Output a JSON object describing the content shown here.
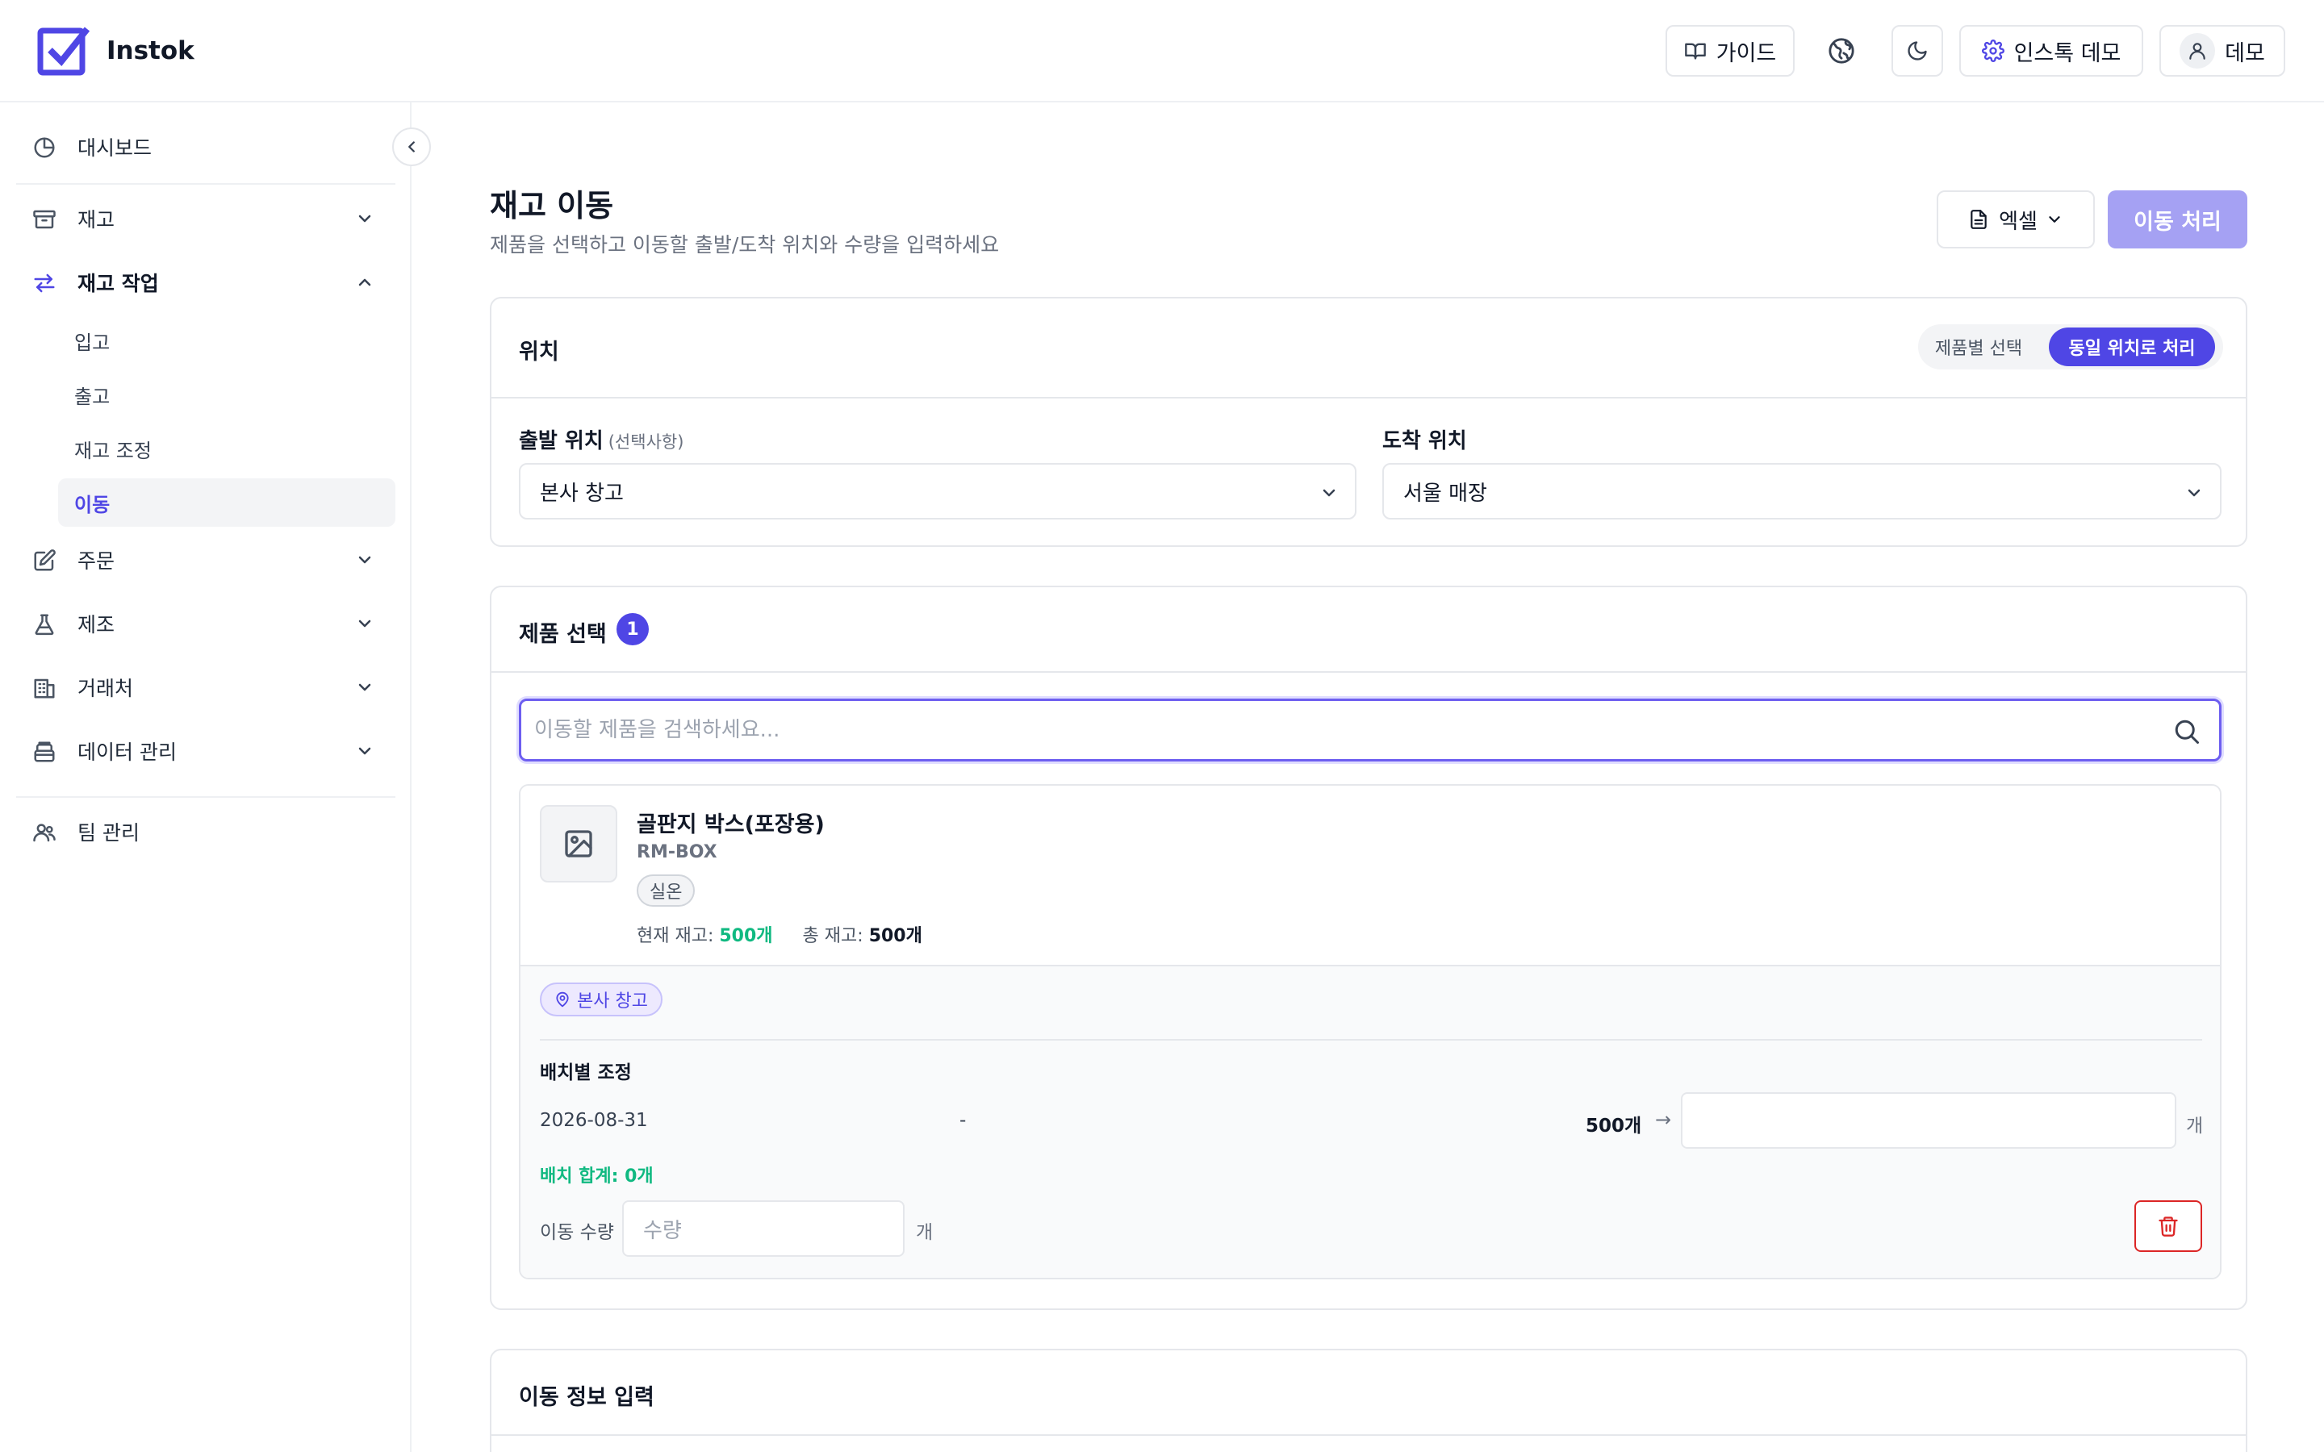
{
  "header": {
    "app_name": "Instok",
    "guide_label": "가이드",
    "org_label": "인스톡 데모",
    "user_label": "데모",
    "icons": [
      "logo-check-icon",
      "book-icon",
      "globe-icon",
      "moon-icon",
      "gear-icon",
      "user-icon"
    ]
  },
  "sidebar": {
    "dashboard": "대시보드",
    "inventory": "재고",
    "inventory_ops": "재고 작업",
    "sub_items": [
      "입고",
      "출고",
      "재고 조정",
      "이동"
    ],
    "active_sub": "이동",
    "orders": "주문",
    "manufacturing": "제조",
    "partners": "거래처",
    "data_mgmt": "데이터 관리",
    "team_mgmt": "팀 관리"
  },
  "page": {
    "title": "재고 이동",
    "subtitle": "제품을 선택하고 이동할 출발/도착 위치와 수량을 입력하세요",
    "excel_label": "엑셀",
    "submit_label": "이동 처리"
  },
  "location": {
    "title": "위치",
    "toggle_per_product": "제품별 선택",
    "toggle_same_location": "동일 위치로 처리",
    "toggle_selected": "동일 위치로 처리",
    "from_label": "출발 위치",
    "from_optional": "(선택사항)",
    "from_value": "본사 창고",
    "to_label": "도착 위치",
    "to_value": "서울 매장"
  },
  "product_select": {
    "title": "제품 선택",
    "count": "1",
    "search_placeholder": "이동할 제품을 검색하세요...",
    "search_value": "",
    "item": {
      "name": "골판지 박스(포장용)",
      "sku": "RM-BOX",
      "tag": "실온",
      "current_stock_label": "현재 재고:",
      "current_stock_value": "500개",
      "total_stock_label": "총 재고:",
      "total_stock_value": "500개",
      "location_chip": "본사 창고",
      "batch_title": "배치별 조정",
      "batch": {
        "date": "2026-08-31",
        "lot": "-",
        "qty": "500개",
        "arrow": "→",
        "input_value": "",
        "unit": "개"
      },
      "batch_sum": "배치 합계: 0개",
      "move_qty_label": "이동 수량",
      "move_qty_placeholder": "수량",
      "move_qty_unit": "개"
    }
  },
  "move_info": {
    "title": "이동 정보 입력"
  },
  "colors": {
    "accent": "#4f46e5",
    "accent_disabled": "#a5a1f3",
    "success": "#10b981",
    "danger": "#dc2626"
  }
}
